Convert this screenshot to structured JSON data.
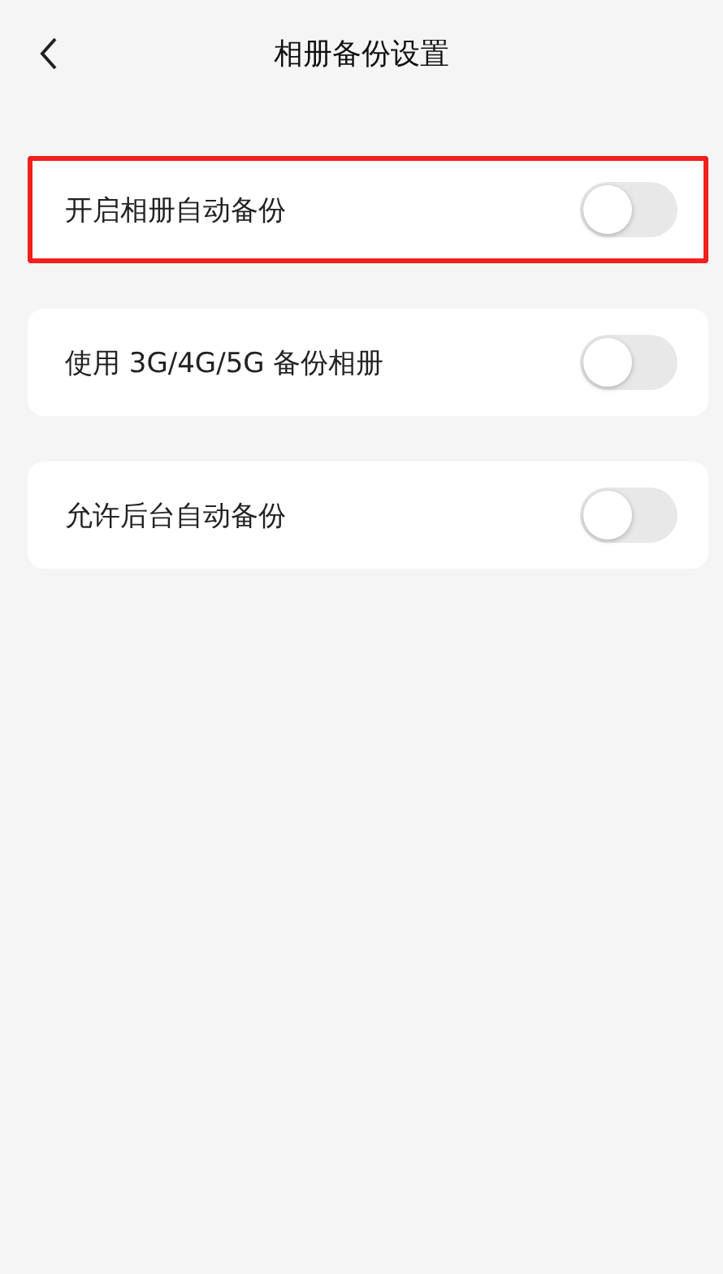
{
  "header": {
    "title": "相册备份设置"
  },
  "settings": [
    {
      "label": "开启相册自动备份",
      "on": false,
      "highlighted": true
    },
    {
      "label": "使用 3G/4G/5G 备份相册",
      "on": false,
      "highlighted": false
    },
    {
      "label": "允许后台自动备份",
      "on": false,
      "highlighted": false
    }
  ]
}
